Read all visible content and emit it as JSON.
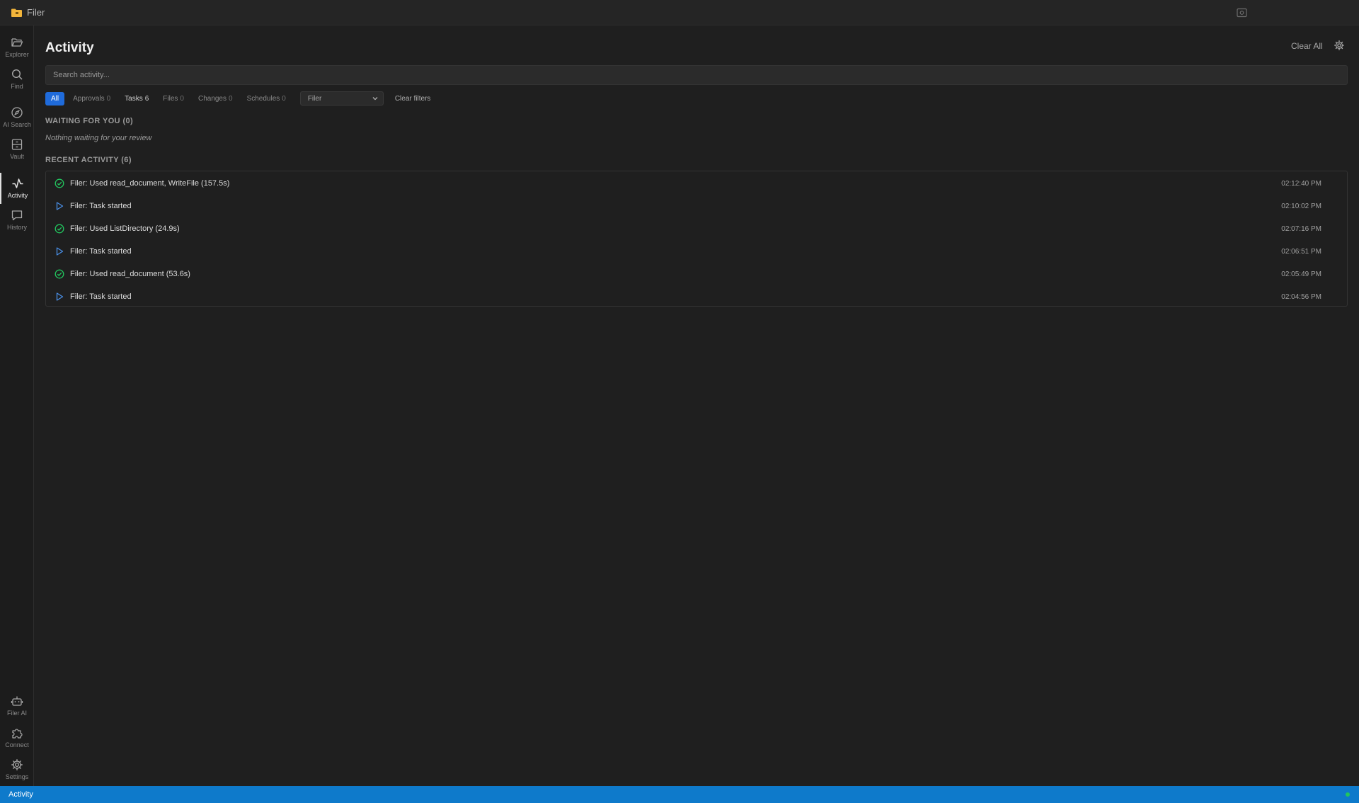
{
  "app": {
    "title": "Filer"
  },
  "sidebar": {
    "top_items": [
      {
        "label": "Explorer",
        "icon": "folder-open-icon"
      },
      {
        "label": "Find",
        "icon": "search-icon"
      },
      {
        "label": "AI Search",
        "icon": "compass-icon"
      },
      {
        "label": "Vault",
        "icon": "archive-icon"
      },
      {
        "label": "Activity",
        "icon": "activity-icon",
        "active": true
      },
      {
        "label": "History",
        "icon": "chat-bubble-icon"
      }
    ],
    "bottom_items": [
      {
        "label": "Filer AI",
        "icon": "robot-icon"
      },
      {
        "label": "Connect",
        "icon": "puzzle-icon"
      },
      {
        "label": "Settings",
        "icon": "gear-icon"
      }
    ]
  },
  "main": {
    "title": "Activity",
    "clear_all": "Clear All",
    "search": {
      "placeholder": "Search activity...",
      "value": ""
    },
    "filters": {
      "all": "All",
      "approvals": {
        "label": "Approvals",
        "count": "0"
      },
      "tasks": {
        "label": "Tasks",
        "count": "6"
      },
      "files": {
        "label": "Files",
        "count": "0"
      },
      "changes": {
        "label": "Changes",
        "count": "0"
      },
      "schedules": {
        "label": "Schedules",
        "count": "0"
      },
      "source_select": "Filer",
      "clear_filters": "Clear filters"
    },
    "waiting": {
      "heading": "WAITING FOR YOU (0)",
      "empty": "Nothing waiting for your review"
    },
    "recent": {
      "heading": "RECENT ACTIVITY (6)",
      "items": [
        {
          "text": "Filer: Used read_document, WriteFile (157.5s)",
          "time": "02:12:40 PM",
          "status": "completed",
          "icon": "check-circle-icon"
        },
        {
          "text": "Filer: Task started",
          "time": "02:10:02 PM",
          "status": "started",
          "icon": "play-icon"
        },
        {
          "text": "Filer: Used ListDirectory (24.9s)",
          "time": "02:07:16 PM",
          "status": "completed",
          "icon": "check-circle-icon"
        },
        {
          "text": "Filer: Task started",
          "time": "02:06:51 PM",
          "status": "started",
          "icon": "play-icon"
        },
        {
          "text": "Filer: Used read_document (53.6s)",
          "time": "02:05:49 PM",
          "status": "completed",
          "icon": "check-circle-icon"
        },
        {
          "text": "Filer: Task started",
          "time": "02:04:56 PM",
          "status": "started",
          "icon": "play-icon"
        }
      ]
    }
  },
  "statusbar": {
    "label": "Activity"
  },
  "colors": {
    "accent": "#1f6bdb",
    "statusbar": "#0e7acb",
    "success": "#22c55e",
    "play": "#4a8fe7",
    "folder": "#f2b53b"
  }
}
